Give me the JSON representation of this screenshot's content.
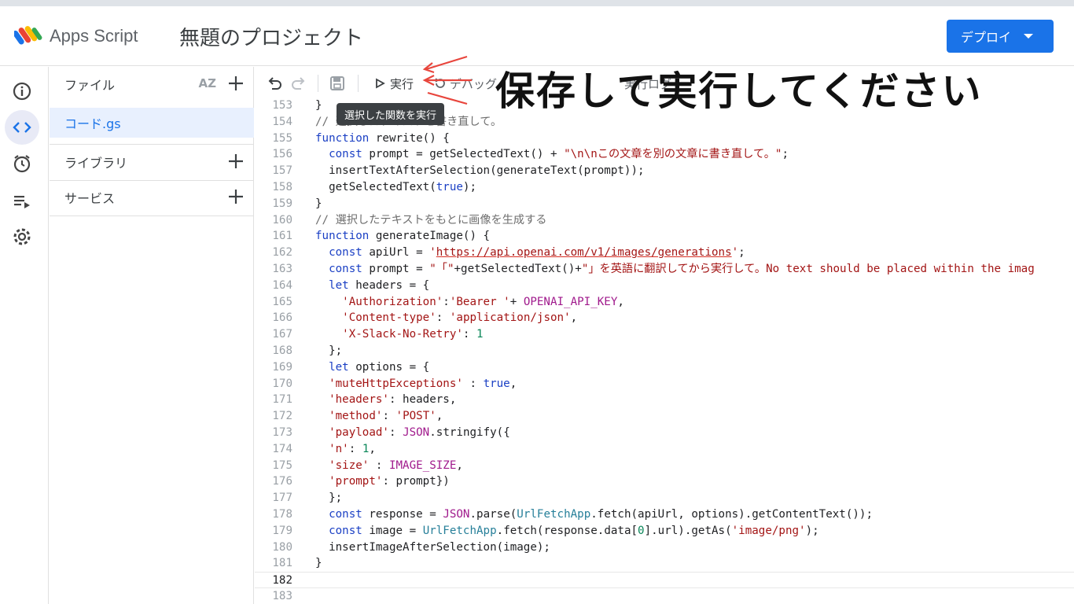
{
  "header": {
    "app_name": "Apps Script",
    "project_title": "無題のプロジェクト",
    "deploy_label": "デプロイ"
  },
  "rail": [
    {
      "icon": "info-icon"
    },
    {
      "icon": "code-icon",
      "active": true
    },
    {
      "icon": "alarm-icon"
    },
    {
      "icon": "executions-icon"
    },
    {
      "icon": "gear-icon"
    }
  ],
  "filepane": {
    "files_label": "ファイル",
    "sort_label": "AZ",
    "active_file": "コード.gs",
    "libraries_label": "ライブラリ",
    "services_label": "サービス"
  },
  "toolbar": {
    "run_label": "実行",
    "debug_label": "デバッグ",
    "log_label": "実行ログ",
    "tooltip": "選択した関数を実行"
  },
  "annotation": "保存して実行してください",
  "editor": {
    "current_line": 182,
    "lines": [
      {
        "n": "153",
        "segs": [
          {
            "t": "}",
            "c": ""
          }
        ]
      },
      {
        "n": "154",
        "segs": [
          {
            "t": "// 選択したテキストを書き直して。",
            "c": "cm"
          }
        ]
      },
      {
        "n": "155",
        "segs": [
          {
            "t": "function",
            "c": "kw"
          },
          {
            "t": " rewrite() {",
            "c": ""
          }
        ]
      },
      {
        "n": "156",
        "segs": [
          {
            "t": "  ",
            "c": ""
          },
          {
            "t": "const",
            "c": "kw"
          },
          {
            "t": " prompt = getSelectedText() + ",
            "c": ""
          },
          {
            "t": "\"\\n\\nこの文章を別の文章に書き直して。\"",
            "c": "str"
          },
          {
            "t": ";",
            "c": ""
          }
        ]
      },
      {
        "n": "157",
        "segs": [
          {
            "t": "  insertTextAfterSelection(generateText(prompt));",
            "c": ""
          }
        ]
      },
      {
        "n": "158",
        "segs": [
          {
            "t": "  getSelectedText(",
            "c": ""
          },
          {
            "t": "true",
            "c": "kw"
          },
          {
            "t": ");",
            "c": ""
          }
        ]
      },
      {
        "n": "159",
        "segs": [
          {
            "t": "}",
            "c": ""
          }
        ]
      },
      {
        "n": "160",
        "segs": [
          {
            "t": "// 選択したテキストをもとに画像を生成する",
            "c": "cm"
          }
        ]
      },
      {
        "n": "161",
        "segs": [
          {
            "t": "function",
            "c": "kw"
          },
          {
            "t": " generateImage() {",
            "c": ""
          }
        ]
      },
      {
        "n": "162",
        "segs": [
          {
            "t": "  ",
            "c": ""
          },
          {
            "t": "const",
            "c": "kw"
          },
          {
            "t": " apiUrl = ",
            "c": ""
          },
          {
            "t": "'",
            "c": "str"
          },
          {
            "t": "https://api.openai.com/v1/images/generations",
            "c": "url"
          },
          {
            "t": "'",
            "c": "str"
          },
          {
            "t": ";",
            "c": ""
          }
        ]
      },
      {
        "n": "163",
        "segs": [
          {
            "t": "  ",
            "c": ""
          },
          {
            "t": "const",
            "c": "kw"
          },
          {
            "t": " prompt = ",
            "c": ""
          },
          {
            "t": "\"「\"",
            "c": "str"
          },
          {
            "t": "+getSelectedText()+",
            "c": ""
          },
          {
            "t": "\"」を英語に翻訳してから実行して。No text should be placed within the imag",
            "c": "str"
          }
        ]
      },
      {
        "n": "164",
        "segs": [
          {
            "t": "  ",
            "c": ""
          },
          {
            "t": "let",
            "c": "kw"
          },
          {
            "t": " headers = {",
            "c": ""
          }
        ]
      },
      {
        "n": "165",
        "segs": [
          {
            "t": "    ",
            "c": ""
          },
          {
            "t": "'Authorization'",
            "c": "str"
          },
          {
            "t": ":",
            "c": ""
          },
          {
            "t": "'Bearer '",
            "c": "str"
          },
          {
            "t": "+ ",
            "c": ""
          },
          {
            "t": "OPENAI_API_KEY",
            "c": "const"
          },
          {
            "t": ",",
            "c": ""
          }
        ]
      },
      {
        "n": "166",
        "segs": [
          {
            "t": "    ",
            "c": ""
          },
          {
            "t": "'Content-type'",
            "c": "str"
          },
          {
            "t": ": ",
            "c": ""
          },
          {
            "t": "'application/json'",
            "c": "str"
          },
          {
            "t": ",",
            "c": ""
          }
        ]
      },
      {
        "n": "167",
        "segs": [
          {
            "t": "    ",
            "c": ""
          },
          {
            "t": "'X-Slack-No-Retry'",
            "c": "str"
          },
          {
            "t": ": ",
            "c": ""
          },
          {
            "t": "1",
            "c": "num"
          }
        ]
      },
      {
        "n": "168",
        "segs": [
          {
            "t": "  };",
            "c": ""
          }
        ]
      },
      {
        "n": "169",
        "segs": [
          {
            "t": "  ",
            "c": ""
          },
          {
            "t": "let",
            "c": "kw"
          },
          {
            "t": " options = {",
            "c": ""
          }
        ]
      },
      {
        "n": "170",
        "segs": [
          {
            "t": "  ",
            "c": ""
          },
          {
            "t": "'muteHttpExceptions'",
            "c": "str"
          },
          {
            "t": " : ",
            "c": ""
          },
          {
            "t": "true",
            "c": "kw"
          },
          {
            "t": ",",
            "c": ""
          }
        ]
      },
      {
        "n": "171",
        "segs": [
          {
            "t": "  ",
            "c": ""
          },
          {
            "t": "'headers'",
            "c": "str"
          },
          {
            "t": ": headers,",
            "c": ""
          }
        ]
      },
      {
        "n": "172",
        "segs": [
          {
            "t": "  ",
            "c": ""
          },
          {
            "t": "'method'",
            "c": "str"
          },
          {
            "t": ": ",
            "c": ""
          },
          {
            "t": "'POST'",
            "c": "str"
          },
          {
            "t": ",",
            "c": ""
          }
        ]
      },
      {
        "n": "173",
        "segs": [
          {
            "t": "  ",
            "c": ""
          },
          {
            "t": "'payload'",
            "c": "str"
          },
          {
            "t": ": ",
            "c": ""
          },
          {
            "t": "JSON",
            "c": "const"
          },
          {
            "t": ".stringify({",
            "c": ""
          }
        ]
      },
      {
        "n": "174",
        "segs": [
          {
            "t": "  ",
            "c": ""
          },
          {
            "t": "'n'",
            "c": "str"
          },
          {
            "t": ": ",
            "c": ""
          },
          {
            "t": "1",
            "c": "num"
          },
          {
            "t": ",",
            "c": ""
          }
        ]
      },
      {
        "n": "175",
        "segs": [
          {
            "t": "  ",
            "c": ""
          },
          {
            "t": "'size'",
            "c": "str"
          },
          {
            "t": " : ",
            "c": ""
          },
          {
            "t": "IMAGE_SIZE",
            "c": "const"
          },
          {
            "t": ",",
            "c": ""
          }
        ]
      },
      {
        "n": "176",
        "segs": [
          {
            "t": "  ",
            "c": ""
          },
          {
            "t": "'prompt'",
            "c": "str"
          },
          {
            "t": ": prompt})",
            "c": ""
          }
        ]
      },
      {
        "n": "177",
        "segs": [
          {
            "t": "  };",
            "c": ""
          }
        ]
      },
      {
        "n": "178",
        "segs": [
          {
            "t": "  ",
            "c": ""
          },
          {
            "t": "const",
            "c": "kw"
          },
          {
            "t": " response = ",
            "c": ""
          },
          {
            "t": "JSON",
            "c": "const"
          },
          {
            "t": ".parse(",
            "c": ""
          },
          {
            "t": "UrlFetchApp",
            "c": "cls"
          },
          {
            "t": ".fetch(apiUrl, options).getContentText());",
            "c": ""
          }
        ]
      },
      {
        "n": "179",
        "segs": [
          {
            "t": "  ",
            "c": ""
          },
          {
            "t": "const",
            "c": "kw"
          },
          {
            "t": " image = ",
            "c": ""
          },
          {
            "t": "UrlFetchApp",
            "c": "cls"
          },
          {
            "t": ".fetch(response.data[",
            "c": ""
          },
          {
            "t": "0",
            "c": "num"
          },
          {
            "t": "].url).getAs(",
            "c": ""
          },
          {
            "t": "'image/png'",
            "c": "str"
          },
          {
            "t": ");",
            "c": ""
          }
        ]
      },
      {
        "n": "180",
        "segs": [
          {
            "t": "  insertImageAfterSelection(image);",
            "c": ""
          }
        ]
      },
      {
        "n": "181",
        "segs": [
          {
            "t": "}",
            "c": ""
          }
        ]
      },
      {
        "n": "182",
        "segs": []
      },
      {
        "n": "183",
        "segs": []
      }
    ]
  },
  "colors": {
    "accent": "#1a73e8",
    "annotation_arrow": "#e8453c"
  }
}
